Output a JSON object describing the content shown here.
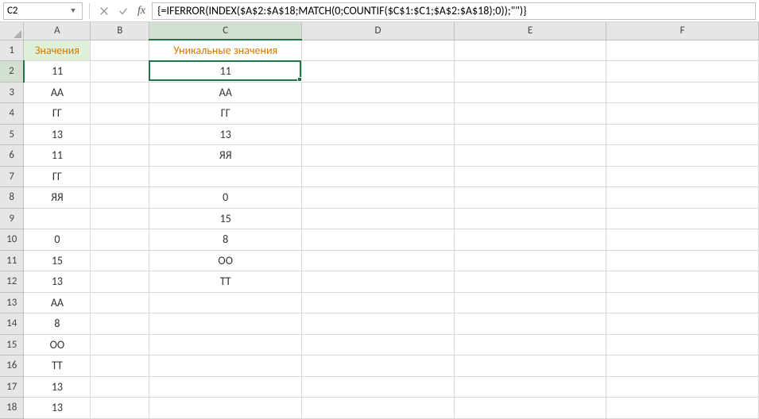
{
  "nameBox": "C2",
  "formula": "{=IFERROR(INDEX($A$2:$A$18;MATCH(0;COUNTIF($C$1:$C1;$A$2:$A$18);0));\"\")}",
  "columns": [
    "A",
    "B",
    "C",
    "D",
    "E",
    "F"
  ],
  "activeCell": {
    "row": 2,
    "col": "C"
  },
  "headers": {
    "A": "Значения",
    "C": "Уникальные значения"
  },
  "colA": [
    "11",
    "АА",
    "ГГ",
    "13",
    "11",
    "ГГ",
    "ЯЯ",
    "",
    "0",
    "15",
    "13",
    "АА",
    "8",
    "ОО",
    "ТТ",
    "13",
    "13"
  ],
  "colC": [
    "11",
    "АА",
    "ГГ",
    "13",
    "ЯЯ",
    "",
    "0",
    "15",
    "8",
    "ОО",
    "ТТ",
    "",
    "",
    "",
    "",
    "",
    ""
  ],
  "rowCount": 18
}
